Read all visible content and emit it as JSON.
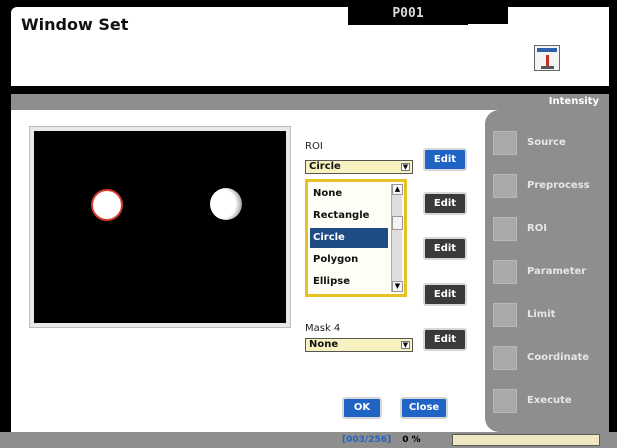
{
  "header": {
    "title": "Window Set",
    "tab_title": "P001",
    "icon": "test-tube-icon"
  },
  "section": {
    "label": "Intensity"
  },
  "preview": {
    "image_name": "binary-preview"
  },
  "roi": {
    "label": "ROI",
    "value": "Circle",
    "edit_label": "Edit"
  },
  "dropdown": {
    "items": [
      "None",
      "Rectangle",
      "Circle",
      "Polygon",
      "Ellipse"
    ],
    "selected": "Circle"
  },
  "rows": [
    {
      "edit_label": "Edit"
    },
    {
      "edit_label": "Edit"
    },
    {
      "edit_label": "Edit"
    },
    {
      "edit_label": "Edit"
    },
    {
      "edit_label": "Edit"
    }
  ],
  "mask4": {
    "label": "Mask 4",
    "value": "None",
    "edit_label": "Edit"
  },
  "actions": {
    "ok": "OK",
    "close": "Close"
  },
  "nav": [
    {
      "label": "Source",
      "icon": "source-icon"
    },
    {
      "label": "Preprocess",
      "icon": "preprocess-icon"
    },
    {
      "label": "ROI",
      "icon": "roi-icon"
    },
    {
      "label": "Parameter",
      "icon": "parameter-icon"
    },
    {
      "label": "Limit",
      "icon": "limit-icon"
    },
    {
      "label": "Coordinate",
      "icon": "coordinate-icon"
    },
    {
      "label": "Execute",
      "icon": "execute-icon"
    }
  ],
  "status": {
    "counter": "[003/256]",
    "percent": "0 %"
  },
  "colors": {
    "accent": "#1f63c5",
    "selection": "#1f4c85",
    "highlight": "#e8c224",
    "panel": "#8e8e8e"
  }
}
